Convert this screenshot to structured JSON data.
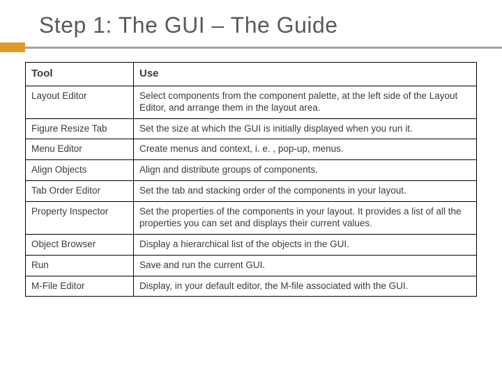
{
  "title": "Step 1: The GUI – The Guide",
  "table": {
    "headers": {
      "tool": "Tool",
      "use": "Use"
    },
    "rows": [
      {
        "tool": "Layout Editor",
        "use": "Select components from the component palette, at the left side of the Layout Editor, and arrange them in the layout area."
      },
      {
        "tool": "Figure Resize Tab",
        "use": "Set the size at which the GUI is initially displayed when you run it."
      },
      {
        "tool": "Menu Editor",
        "use": "Create menus and context, i. e. , pop-up, menus."
      },
      {
        "tool": "Align Objects",
        "use": "Align and distribute groups of components."
      },
      {
        "tool": "Tab Order Editor",
        "use": "Set the tab and stacking order of the components in your layout."
      },
      {
        "tool": "Property Inspector",
        "use": "Set the properties of the components in your layout. It provides a list of all the properties you can set and displays their current values."
      },
      {
        "tool": "Object Browser",
        "use": "Display a hierarchical list of the objects in the GUI."
      },
      {
        "tool": "Run",
        "use": "Save and run the current GUI."
      },
      {
        "tool": "M-File Editor",
        "use": "Display, in your default editor, the M-file associated with the GUI."
      }
    ]
  }
}
